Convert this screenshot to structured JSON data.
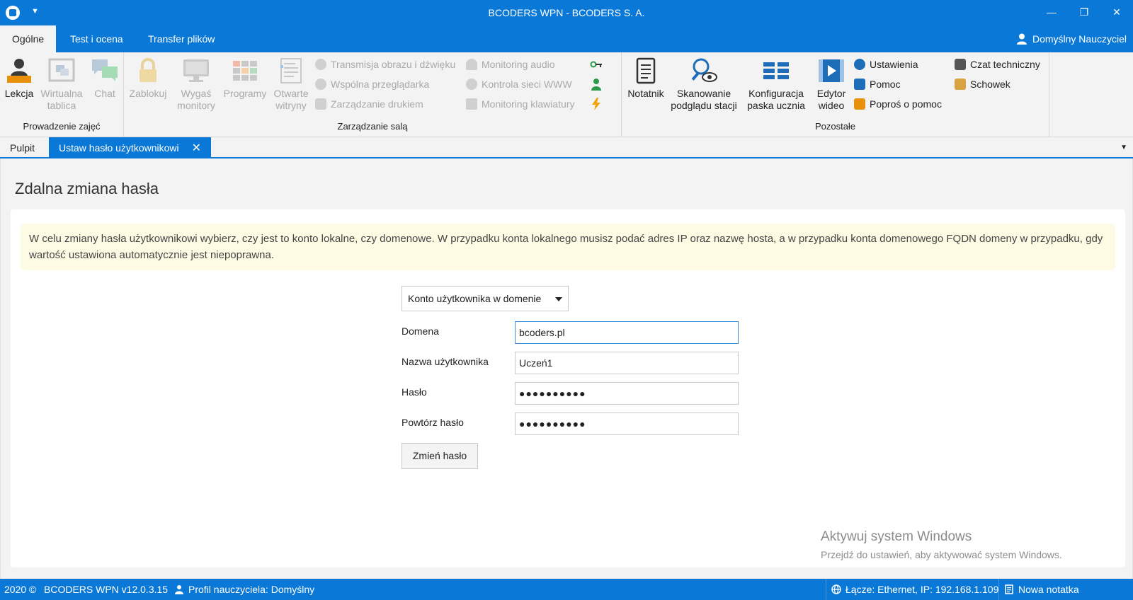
{
  "window": {
    "title": "BCODERS WPN - BCODERS S. A.",
    "quick_access": "▼",
    "minimize": "—",
    "restore": "❐",
    "close": "✕"
  },
  "menu": {
    "tabs": [
      "Ogólne",
      "Test i ocena",
      "Transfer plików"
    ],
    "active_tab": "Ogólne",
    "user": "Domyślny Nauczyciel"
  },
  "ribbon": {
    "group1": {
      "label": "Prowadzenie zajęć",
      "lekcja": "Lekcja",
      "tablica_1": "Wirtualna",
      "tablica_2": "tablica",
      "chat": "Chat"
    },
    "group2": {
      "label": "Zarządzanie salą",
      "zablokuj": "Zablokuj",
      "wygas_1": "Wygaś",
      "wygas_2": "monitory",
      "programy": "Programy",
      "witryny_1": "Otwarte",
      "witryny_2": "witryny",
      "transmisja": "Transmisja obrazu i dźwięku",
      "przegladarka": "Wspólna przeglądarka",
      "drukarki": "Zarządzanie drukiem",
      "audio": "Monitoring audio",
      "www": "Kontrola sieci WWW",
      "klawiatura": "Monitoring klawiatury"
    },
    "group3": {
      "label": "Pozostałe",
      "notatnik": "Notatnik",
      "skan_1": "Skanowanie",
      "skan_2": "podglądu stacji",
      "konfig_1": "Konfiguracja",
      "konfig_2": "paska ucznia",
      "edytor_1": "Edytor",
      "edytor_2": "wideo",
      "ustawienia": "Ustawienia",
      "pomoc": "Pomoc",
      "popros": "Poproś o pomoc",
      "czat": "Czat techniczny",
      "schowek": "Schowek"
    }
  },
  "doc_tabs": {
    "tab1": "Pulpit",
    "tab2": "Ustaw hasło użytkownikowi",
    "close": "✕",
    "dropdown": "▼"
  },
  "page": {
    "title": "Zdalna zmiana hasła",
    "info": "W celu zmiany hasła użytkownikowi wybierz, czy jest to konto lokalne, czy domenowe. W przypadku konta lokalnego musisz podać adres IP oraz nazwę hosta, a w przypadku konta domenowego FQDN domeny w przypadku, gdy wartość ustawiona automatycznie jest niepoprawna.",
    "account_type": "Konto użytkownika w domenie",
    "domain_label": "Domena",
    "domain_value": "bcoders.pl",
    "username_label": "Nazwa użytkownika",
    "username_value": "Uczeń1",
    "password_label": "Hasło",
    "password_value": "●●●●●●●●●●",
    "repeat_label": "Powtórz hasło",
    "repeat_value": "●●●●●●●●●●",
    "submit": "Zmień hasło"
  },
  "watermark": {
    "line1": "Aktywuj system Windows",
    "line2": "Przejdź do ustawień, aby aktywować system Windows."
  },
  "status": {
    "copyright": "2020 ©",
    "version": "BCODERS WPN v12.0.3.15",
    "profile": "Profil nauczyciela: Domyślny",
    "network": "Łącze: Ethernet, IP: 192.168.1.109",
    "note": "Nowa notatka"
  },
  "colors": {
    "accent": "#0a78d6",
    "info_bg": "#fdfbe4",
    "disabled": "#a9a9a9"
  }
}
